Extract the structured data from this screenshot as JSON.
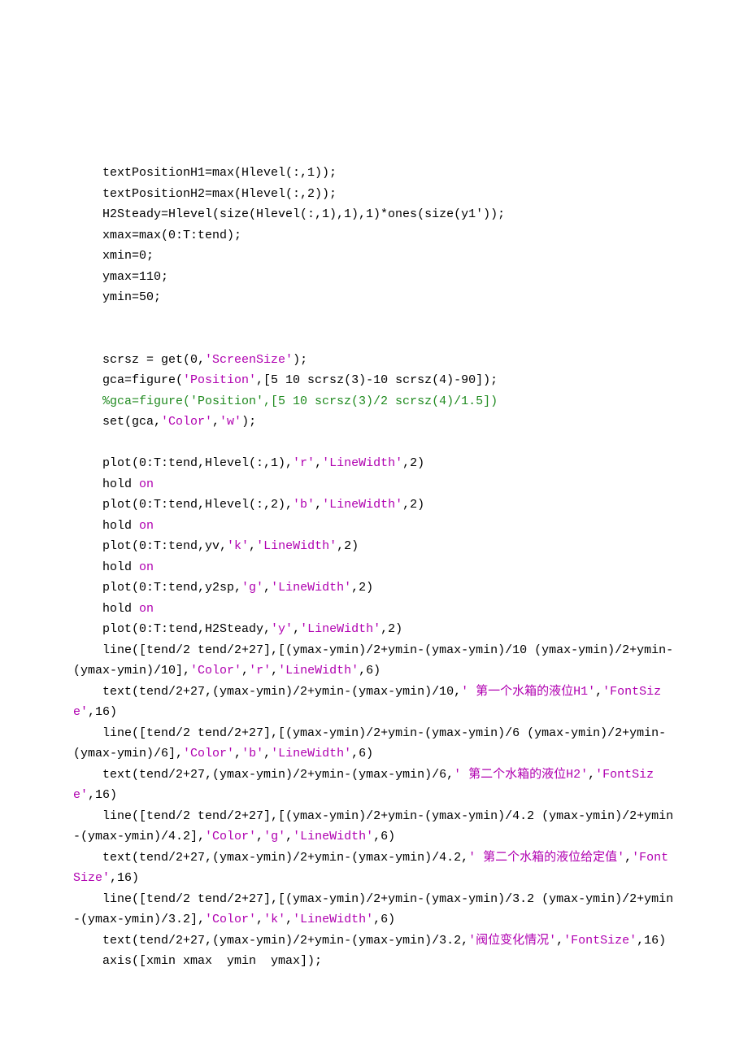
{
  "code": {
    "lines": [
      {
        "indent": 1,
        "segs": [
          {
            "t": "textPositionH1=max(Hlevel(:,1));",
            "c": "plain"
          }
        ]
      },
      {
        "indent": 1,
        "segs": [
          {
            "t": "textPositionH2=max(Hlevel(:,2));",
            "c": "plain"
          }
        ]
      },
      {
        "indent": 1,
        "segs": [
          {
            "t": "H2Steady=Hlevel(size(Hlevel(:,1),1),1)*ones(size(y1'));",
            "c": "plain"
          }
        ]
      },
      {
        "indent": 1,
        "segs": [
          {
            "t": "xmax=max(0:T:tend);",
            "c": "plain"
          }
        ]
      },
      {
        "indent": 1,
        "segs": [
          {
            "t": "xmin=0;",
            "c": "plain"
          }
        ]
      },
      {
        "indent": 1,
        "segs": [
          {
            "t": "ymax=110;",
            "c": "plain"
          }
        ]
      },
      {
        "indent": 1,
        "segs": [
          {
            "t": "ymin=50;",
            "c": "plain"
          }
        ]
      },
      {
        "indent": 1,
        "segs": [
          {
            "t": "",
            "c": "plain"
          }
        ]
      },
      {
        "indent": 1,
        "segs": [
          {
            "t": "",
            "c": "plain"
          }
        ]
      },
      {
        "indent": 1,
        "segs": [
          {
            "t": "scrsz = get(0,",
            "c": "plain"
          },
          {
            "t": "'ScreenSize'",
            "c": "str"
          },
          {
            "t": ");",
            "c": "plain"
          }
        ]
      },
      {
        "indent": 1,
        "segs": [
          {
            "t": "gca=figure(",
            "c": "plain"
          },
          {
            "t": "'Position'",
            "c": "str"
          },
          {
            "t": ",[5 10 scrsz(3)-10 scrsz(4)-90]);",
            "c": "plain"
          }
        ]
      },
      {
        "indent": 1,
        "segs": [
          {
            "t": "%gca=figure('Position',[5 10 scrsz(3)/2 scrsz(4)/1.5])",
            "c": "com"
          }
        ]
      },
      {
        "indent": 1,
        "segs": [
          {
            "t": "set(gca,",
            "c": "plain"
          },
          {
            "t": "'Color'",
            "c": "str"
          },
          {
            "t": ",",
            "c": "plain"
          },
          {
            "t": "'w'",
            "c": "str"
          },
          {
            "t": ");",
            "c": "plain"
          }
        ]
      },
      {
        "indent": 1,
        "segs": [
          {
            "t": "",
            "c": "plain"
          }
        ]
      },
      {
        "indent": 1,
        "segs": [
          {
            "t": "plot(0:T:tend,Hlevel(:,1),",
            "c": "plain"
          },
          {
            "t": "'r'",
            "c": "str"
          },
          {
            "t": ",",
            "c": "plain"
          },
          {
            "t": "'LineWidth'",
            "c": "str"
          },
          {
            "t": ",2)",
            "c": "plain"
          }
        ]
      },
      {
        "indent": 1,
        "segs": [
          {
            "t": "hold ",
            "c": "plain"
          },
          {
            "t": "on",
            "c": "str"
          }
        ]
      },
      {
        "indent": 1,
        "segs": [
          {
            "t": "plot(0:T:tend,Hlevel(:,2),",
            "c": "plain"
          },
          {
            "t": "'b'",
            "c": "str"
          },
          {
            "t": ",",
            "c": "plain"
          },
          {
            "t": "'LineWidth'",
            "c": "str"
          },
          {
            "t": ",2)",
            "c": "plain"
          }
        ]
      },
      {
        "indent": 1,
        "segs": [
          {
            "t": "hold ",
            "c": "plain"
          },
          {
            "t": "on",
            "c": "str"
          }
        ]
      },
      {
        "indent": 1,
        "segs": [
          {
            "t": "plot(0:T:tend,yv,",
            "c": "plain"
          },
          {
            "t": "'k'",
            "c": "str"
          },
          {
            "t": ",",
            "c": "plain"
          },
          {
            "t": "'LineWidth'",
            "c": "str"
          },
          {
            "t": ",2)",
            "c": "plain"
          }
        ]
      },
      {
        "indent": 1,
        "segs": [
          {
            "t": "hold ",
            "c": "plain"
          },
          {
            "t": "on",
            "c": "str"
          }
        ]
      },
      {
        "indent": 1,
        "segs": [
          {
            "t": "plot(0:T:tend,y2sp,",
            "c": "plain"
          },
          {
            "t": "'g'",
            "c": "str"
          },
          {
            "t": ",",
            "c": "plain"
          },
          {
            "t": "'LineWidth'",
            "c": "str"
          },
          {
            "t": ",2)",
            "c": "plain"
          }
        ]
      },
      {
        "indent": 1,
        "segs": [
          {
            "t": "hold ",
            "c": "plain"
          },
          {
            "t": "on",
            "c": "str"
          }
        ]
      },
      {
        "indent": 1,
        "segs": [
          {
            "t": "plot(0:T:tend,H2Steady,",
            "c": "plain"
          },
          {
            "t": "'y'",
            "c": "str"
          },
          {
            "t": ",",
            "c": "plain"
          },
          {
            "t": "'LineWidth'",
            "c": "str"
          },
          {
            "t": ",2)",
            "c": "plain"
          }
        ]
      },
      {
        "indent": 1,
        "wrap": true,
        "segs": [
          {
            "t": "line([tend/2 tend/2+27],[(ymax-ymin)/2+ymin-(ymax-ymin)/10 (ymax-ymin)/2+ymin-(ymax-ymin)/10],",
            "c": "plain"
          },
          {
            "t": "'Color'",
            "c": "str"
          },
          {
            "t": ",",
            "c": "plain"
          },
          {
            "t": "'r'",
            "c": "str"
          },
          {
            "t": ",",
            "c": "plain"
          },
          {
            "t": "'LineWidth'",
            "c": "str"
          },
          {
            "t": ",6)",
            "c": "plain"
          }
        ]
      },
      {
        "indent": 1,
        "wrap": true,
        "segs": [
          {
            "t": "text(tend/2+27,(ymax-ymin)/2+ymin-(ymax-ymin)/10,",
            "c": "plain"
          },
          {
            "t": "' 第一个水箱的液位H1'",
            "c": "str"
          },
          {
            "t": ",",
            "c": "plain"
          },
          {
            "t": "'FontSize'",
            "c": "str"
          },
          {
            "t": ",16)",
            "c": "plain"
          }
        ]
      },
      {
        "indent": 1,
        "wrap": true,
        "segs": [
          {
            "t": "line([tend/2 tend/2+27],[(ymax-ymin)/2+ymin-(ymax-ymin)/6 (ymax-ymin)/2+ymin-(ymax-ymin)/6],",
            "c": "plain"
          },
          {
            "t": "'Color'",
            "c": "str"
          },
          {
            "t": ",",
            "c": "plain"
          },
          {
            "t": "'b'",
            "c": "str"
          },
          {
            "t": ",",
            "c": "plain"
          },
          {
            "t": "'LineWidth'",
            "c": "str"
          },
          {
            "t": ",6)",
            "c": "plain"
          }
        ]
      },
      {
        "indent": 1,
        "wrap": true,
        "segs": [
          {
            "t": "text(tend/2+27,(ymax-ymin)/2+ymin-(ymax-ymin)/6,",
            "c": "plain"
          },
          {
            "t": "' 第二个水箱的液位H2'",
            "c": "str"
          },
          {
            "t": ",",
            "c": "plain"
          },
          {
            "t": "'FontSize'",
            "c": "str"
          },
          {
            "t": ",16)",
            "c": "plain"
          }
        ]
      },
      {
        "indent": 1,
        "wrap": true,
        "segs": [
          {
            "t": "line([tend/2 tend/2+27],[(ymax-ymin)/2+ymin-(ymax-ymin)/4.2 (ymax-ymin)/2+ymin-(ymax-ymin)/4.2],",
            "c": "plain"
          },
          {
            "t": "'Color'",
            "c": "str"
          },
          {
            "t": ",",
            "c": "plain"
          },
          {
            "t": "'g'",
            "c": "str"
          },
          {
            "t": ",",
            "c": "plain"
          },
          {
            "t": "'LineWidth'",
            "c": "str"
          },
          {
            "t": ",6)",
            "c": "plain"
          }
        ]
      },
      {
        "indent": 1,
        "wrap": true,
        "segs": [
          {
            "t": "text(tend/2+27,(ymax-ymin)/2+ymin-(ymax-ymin)/4.2,",
            "c": "plain"
          },
          {
            "t": "' 第二个水箱的液位给定值'",
            "c": "str"
          },
          {
            "t": ",",
            "c": "plain"
          },
          {
            "t": "'FontSize'",
            "c": "str"
          },
          {
            "t": ",16)",
            "c": "plain"
          }
        ]
      },
      {
        "indent": 1,
        "wrap": true,
        "segs": [
          {
            "t": "line([tend/2 tend/2+27],[(ymax-ymin)/2+ymin-(ymax-ymin)/3.2 (ymax-ymin)/2+ymin-(ymax-ymin)/3.2],",
            "c": "plain"
          },
          {
            "t": "'Color'",
            "c": "str"
          },
          {
            "t": ",",
            "c": "plain"
          },
          {
            "t": "'k'",
            "c": "str"
          },
          {
            "t": ",",
            "c": "plain"
          },
          {
            "t": "'LineWidth'",
            "c": "str"
          },
          {
            "t": ",6)",
            "c": "plain"
          }
        ]
      },
      {
        "indent": 1,
        "wrap": true,
        "segs": [
          {
            "t": "text(tend/2+27,(ymax-ymin)/2+ymin-(ymax-ymin)/3.2,",
            "c": "plain"
          },
          {
            "t": "'阀位变化情况'",
            "c": "str"
          },
          {
            "t": ",",
            "c": "plain"
          },
          {
            "t": "'FontSize'",
            "c": "str"
          },
          {
            "t": ",16)",
            "c": "plain"
          }
        ]
      },
      {
        "indent": 1,
        "segs": [
          {
            "t": "axis([xmin xmax  ymin  ymax]);",
            "c": "plain"
          }
        ]
      }
    ]
  }
}
